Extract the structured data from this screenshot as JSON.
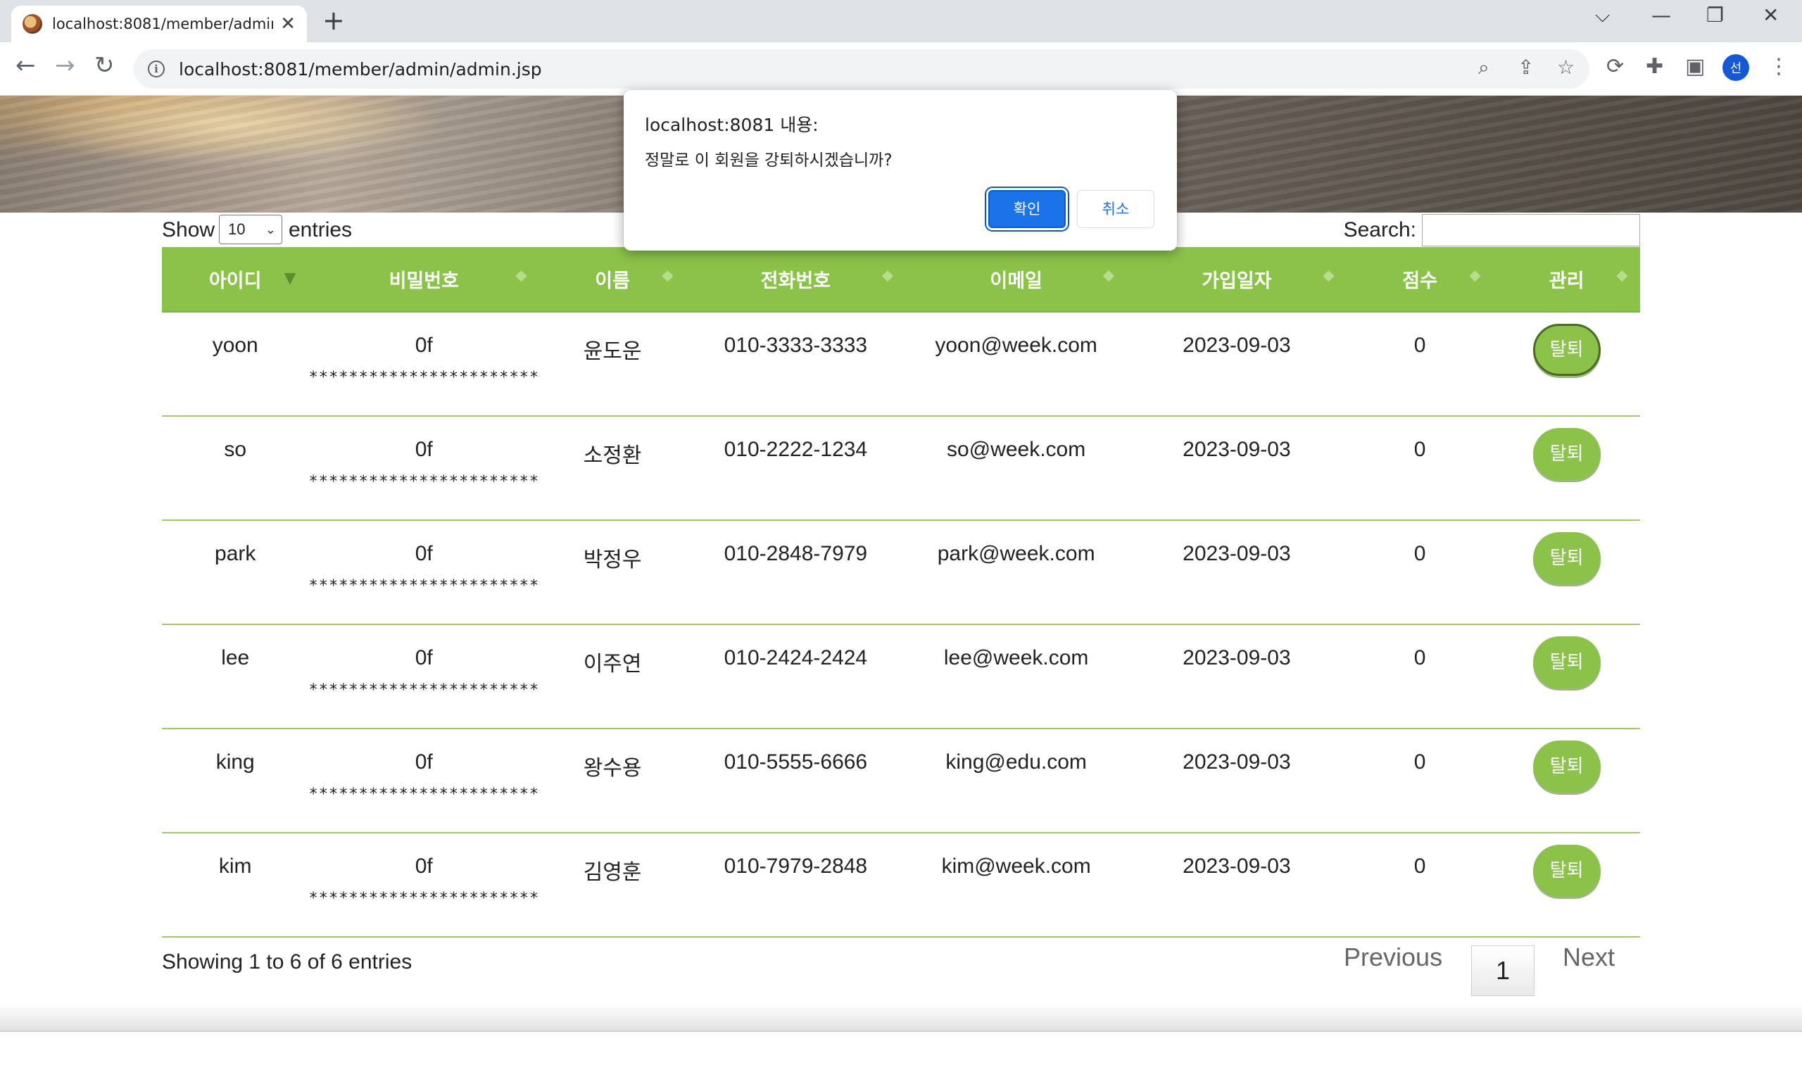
{
  "browser": {
    "tab_title": "localhost:8081/member/admin/admin.jsp",
    "tab_close": "✕",
    "new_tab": "+",
    "url": "localhost:8081/member/admin/admin.jsp",
    "profile_initial": "선",
    "icons": [
      "back-arrow-icon",
      "forward-arrow-icon",
      "reload-icon",
      "info-icon",
      "zoom-icon",
      "share-icon",
      "star-icon",
      "refresh-extension-icon",
      "puzzle-icon",
      "sidepanel-icon",
      "more-icon"
    ]
  },
  "datatable": {
    "length_label_before": "Show",
    "length_value": "10",
    "length_label_after": "entries",
    "search_label": "Search:",
    "search_value": "",
    "columns": [
      "아이디",
      "비밀번호",
      "이름",
      "전화번호",
      "이메일",
      "가입일자",
      "점수",
      "관리"
    ],
    "rows": [
      {
        "id": "yoon",
        "pw": "0f",
        "pw_mask": "***********************",
        "name": "윤도운",
        "phone": "010-3333-3333",
        "email": "yoon@week.com",
        "joined": "2023-09-03",
        "score": "0",
        "action": "탈퇴"
      },
      {
        "id": "so",
        "pw": "0f",
        "pw_mask": "***********************",
        "name": "소정환",
        "phone": "010-2222-1234",
        "email": "so@week.com",
        "joined": "2023-09-03",
        "score": "0",
        "action": "탈퇴"
      },
      {
        "id": "park",
        "pw": "0f",
        "pw_mask": "***********************",
        "name": "박정우",
        "phone": "010-2848-7979",
        "email": "park@week.com",
        "joined": "2023-09-03",
        "score": "0",
        "action": "탈퇴"
      },
      {
        "id": "lee",
        "pw": "0f",
        "pw_mask": "***********************",
        "name": "이주연",
        "phone": "010-2424-2424",
        "email": "lee@week.com",
        "joined": "2023-09-03",
        "score": "0",
        "action": "탈퇴"
      },
      {
        "id": "king",
        "pw": "0f",
        "pw_mask": "***********************",
        "name": "왕수용",
        "phone": "010-5555-6666",
        "email": "king@edu.com",
        "joined": "2023-09-03",
        "score": "0",
        "action": "탈퇴"
      },
      {
        "id": "kim",
        "pw": "0f",
        "pw_mask": "***********************",
        "name": "김영훈",
        "phone": "010-7979-2848",
        "email": "kim@week.com",
        "joined": "2023-09-03",
        "score": "0",
        "action": "탈퇴"
      }
    ],
    "info": "Showing 1 to 6 of 6 entries",
    "pagination": {
      "previous": "Previous",
      "current": "1",
      "next": "Next"
    }
  },
  "dialog": {
    "origin": "localhost:8081 내용:",
    "message": "정말로 이 회원을 강퇴하시겠습니까?",
    "ok": "확인",
    "cancel": "취소"
  },
  "colors": {
    "accent_green": "#8bc34a",
    "dialog_primary": "#1a73e8",
    "chrome_bg": "#dee1e6"
  }
}
